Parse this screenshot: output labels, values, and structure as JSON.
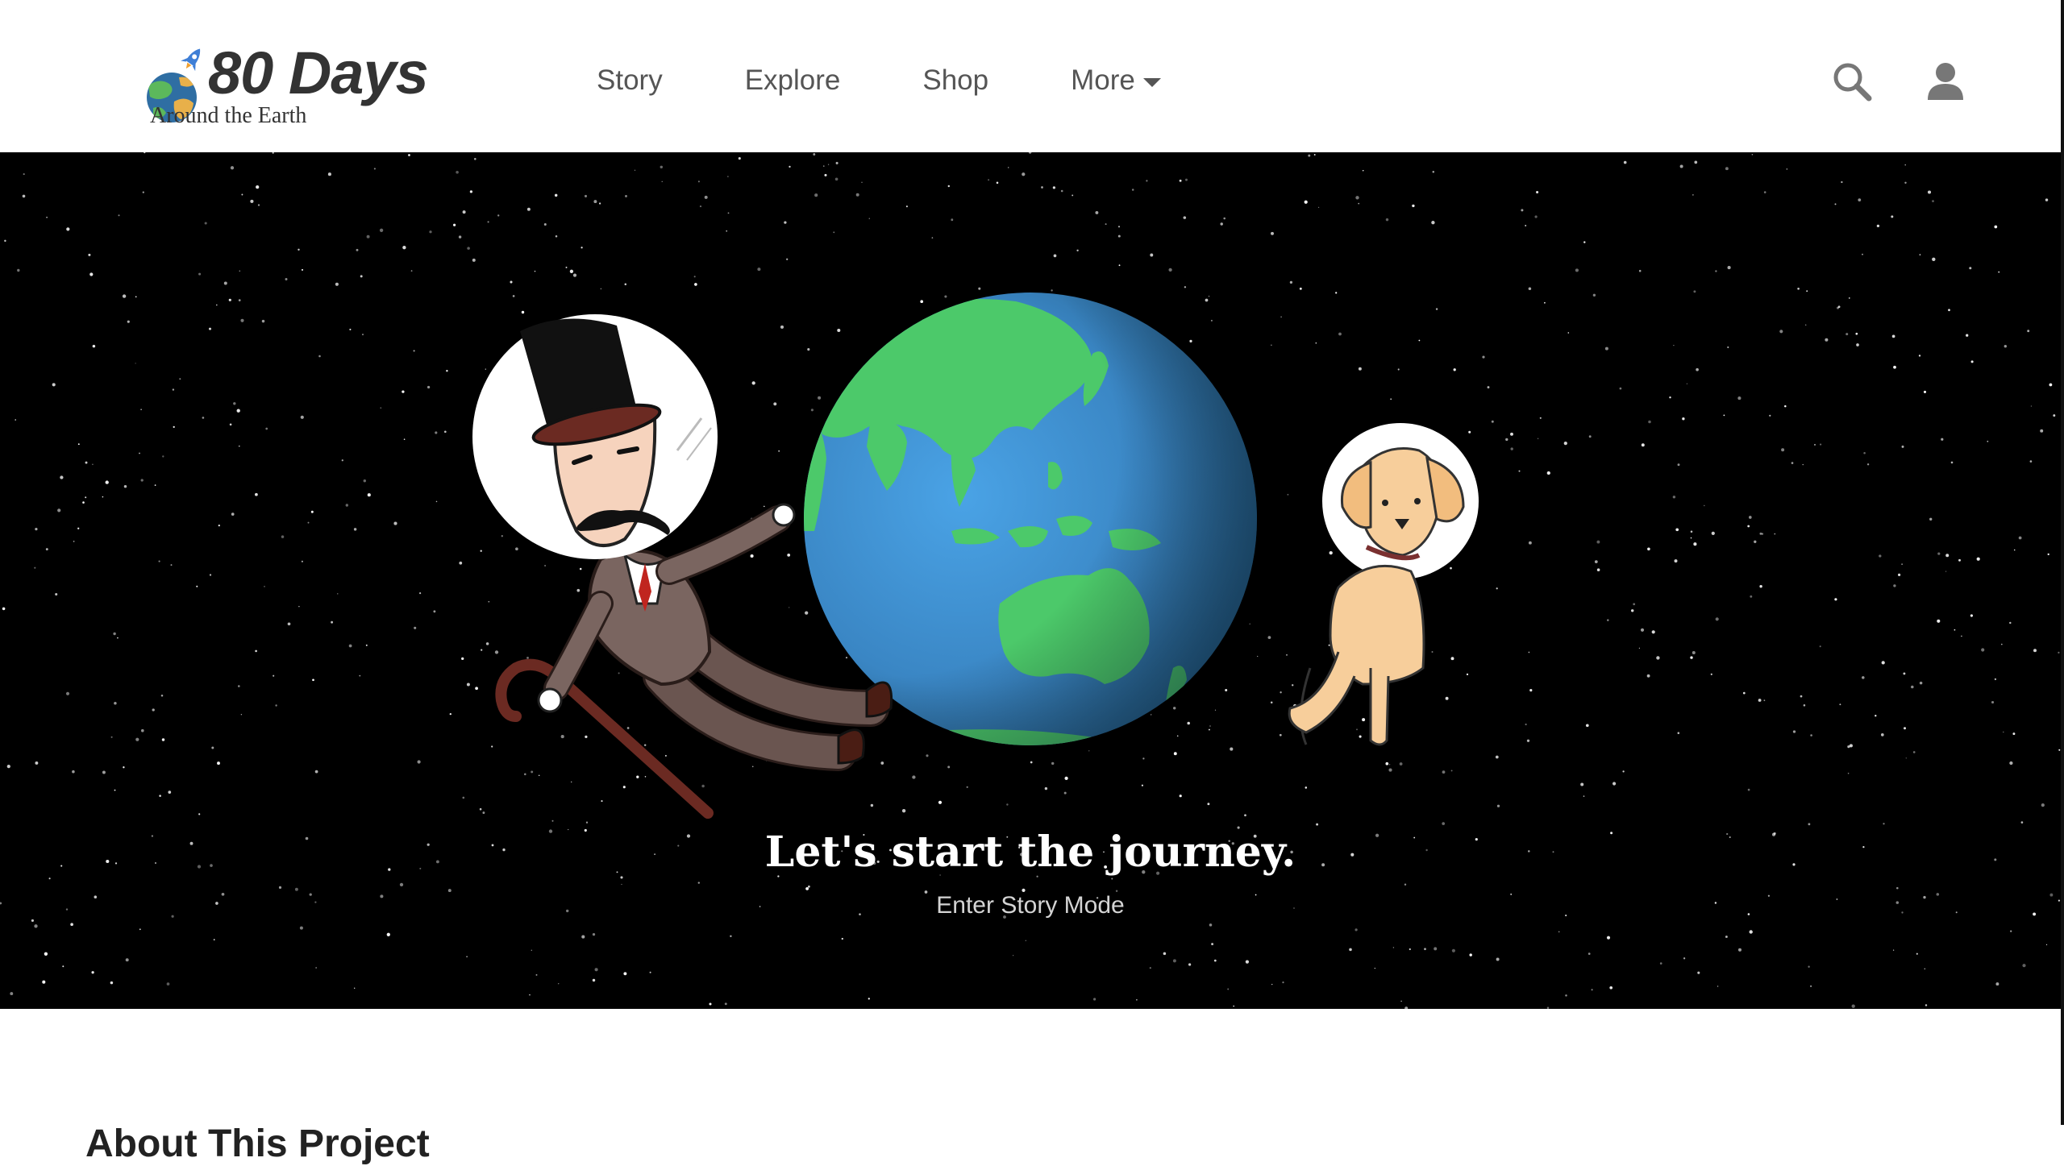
{
  "header": {
    "logo": {
      "title": "80 Days",
      "subtitle": "Around the Earth",
      "icon": "globe-rocket-icon"
    },
    "nav": [
      {
        "label": "Story"
      },
      {
        "label": "Explore"
      },
      {
        "label": "Shop"
      },
      {
        "label": "More",
        "icon": "caret-down-icon"
      }
    ],
    "icons": {
      "search": "search-icon",
      "account": "user-icon"
    }
  },
  "hero": {
    "title": "Let's start the journey.",
    "link": "Enter Story Mode",
    "illustration": [
      "gentleman-astronaut",
      "earth-globe",
      "dog-astronaut"
    ]
  },
  "about": {
    "heading": "About This Project"
  },
  "colors": {
    "header_bg": "#ffffff",
    "hero_bg": "#000000",
    "nav_text": "#555555",
    "ocean": "#3d8fcf",
    "land": "#4cc96a"
  }
}
